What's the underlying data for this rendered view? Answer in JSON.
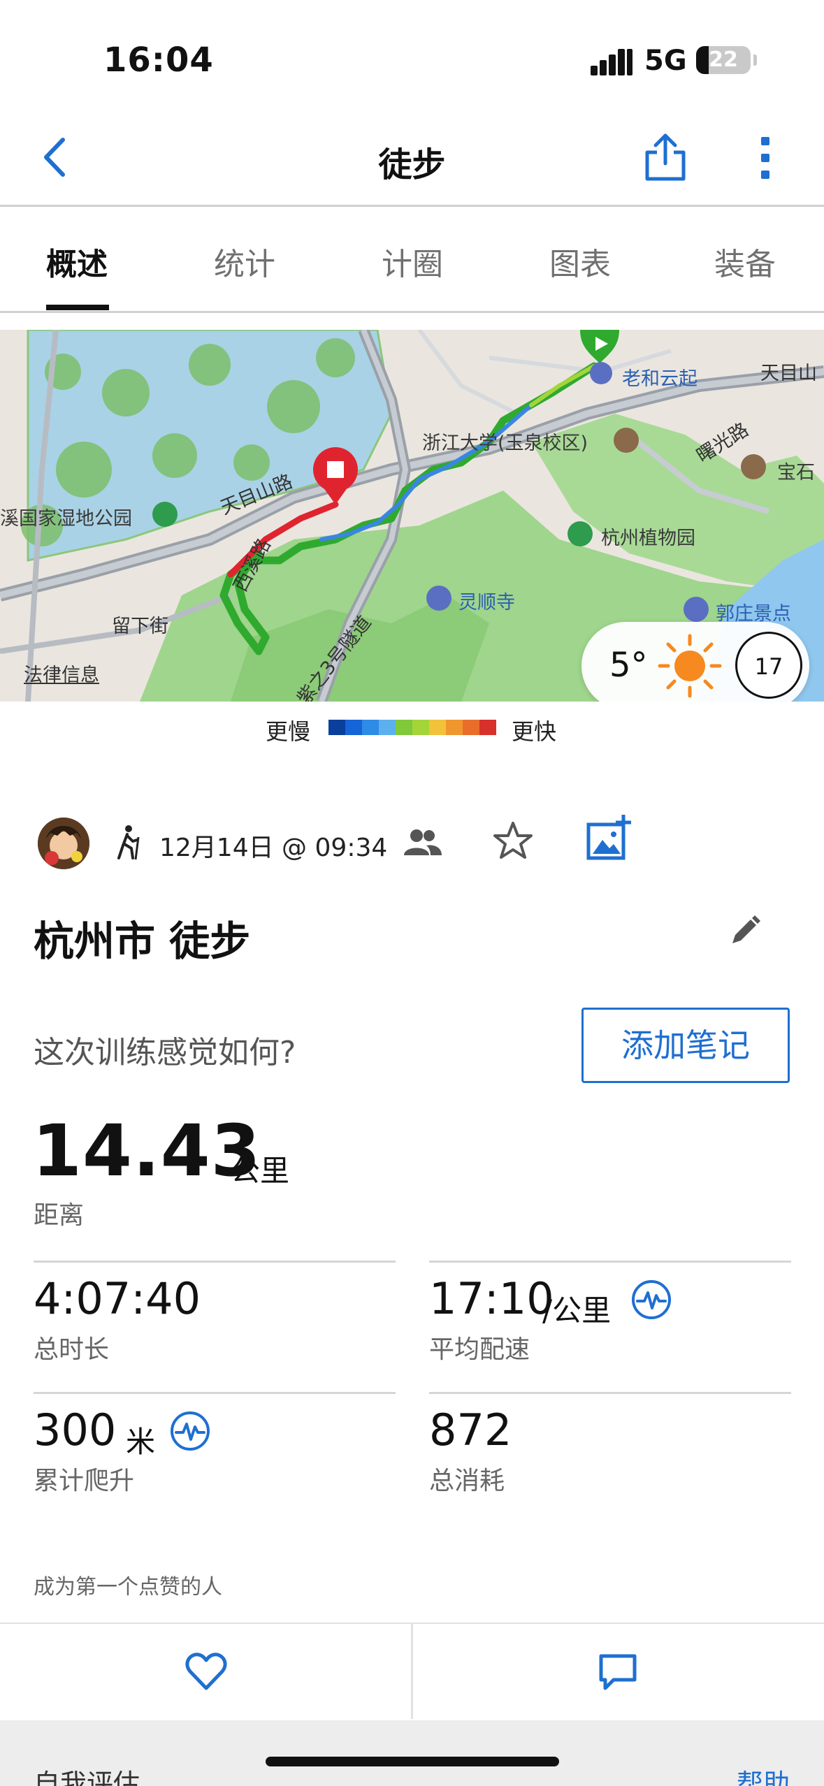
{
  "status_bar": {
    "time": "16:04",
    "network": "5G",
    "battery": "22"
  },
  "nav": {
    "title": "徒步"
  },
  "tabs": [
    {
      "label": "概述",
      "active": true
    },
    {
      "label": "统计",
      "active": false
    },
    {
      "label": "计圈",
      "active": false
    },
    {
      "label": "图表",
      "active": false
    },
    {
      "label": "装备",
      "active": false
    }
  ],
  "map": {
    "labels": {
      "tianmushan_road_1": "天目山路",
      "tianmushan_road_2": "天目山",
      "xixi_wetland": "溪国家湿地公园",
      "zju": "浙江大学(玉泉校区)",
      "laohe_yunqi": "老和云起",
      "shuguang_road": "曙光路",
      "baoshi": "宝石",
      "botanical_garden": "杭州植物园",
      "lingshun_temple": "灵顺寺",
      "guozhuang": "郭庄景点",
      "xixi_road": "西溪路",
      "liuxia_street": "留下街",
      "zizhisan_tunnel": "紫之3号隧道",
      "legal_info": "法律信息"
    },
    "weather": {
      "temperature": "5°",
      "wind": "17"
    }
  },
  "pace_legend": {
    "slow": "更慢",
    "fast": "更快",
    "colors": [
      "#0b3f9c",
      "#1565d8",
      "#2e8be6",
      "#5cb0ee",
      "#7fc93a",
      "#a3d53a",
      "#f2c23a",
      "#f0962e",
      "#e86e2a",
      "#d8302b"
    ]
  },
  "activity": {
    "date": "12月14日 @ 09:34",
    "title": "杭州市 徒步",
    "feel_question": "这次训练感觉如何?",
    "add_note": "添加笔记"
  },
  "stats": {
    "distance": {
      "value": "14.43",
      "unit": "公里",
      "label": "距离"
    },
    "duration": {
      "value": "4:07:40",
      "label": "总时长"
    },
    "avg_pace": {
      "value": "17:10",
      "unit": "/公里",
      "label": "平均配速"
    },
    "ascent": {
      "value": "300",
      "unit": "米",
      "label": "累计爬升"
    },
    "calories": {
      "value": "872",
      "label": "总消耗"
    }
  },
  "social": {
    "like_prompt": "成为第一个点赞的人"
  },
  "bottom": {
    "self_eval": "自我评估",
    "help": "帮助"
  },
  "colors": {
    "accent": "#1f6fd1",
    "route_start": "#2faa2f",
    "route_end": "#e0242f"
  }
}
